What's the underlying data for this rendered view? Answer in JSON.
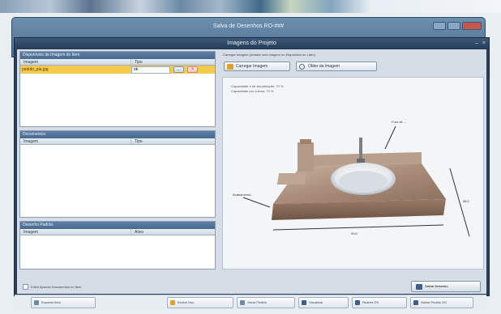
{
  "outer_window": {
    "title": "Salva de Desenhos RO-###"
  },
  "dialog": {
    "title": "Imagens do Projeto",
    "controls": {
      "minimize": "–",
      "close": "×"
    },
    "panels": {
      "images": {
        "title": "Disponíveis de Imagem do Item",
        "col_a": "Imagem",
        "col_b": "Tipo",
        "rows": [
          {
            "name": "pedido_pia.jpg",
            "type": "ok"
          }
        ],
        "row_btn_edit": "...",
        "row_btn_delete": "×"
      },
      "documents": {
        "title": "Documentos",
        "col_a": "Imagem",
        "col_b": "Tipo"
      },
      "other": {
        "title": "Desenho Padrão",
        "col_a": "Imagem",
        "col_b": "Ativo"
      }
    },
    "right": {
      "hint": "Carregar Imagem (Arraste uma imagem ou Dispositivo ao Lado)",
      "btn_load": "Carregar Imagem",
      "btn_view": "Obter da Imagem",
      "info_line1": "Capacidade e de visualização: 70 %",
      "info_line2": "Capacidade por coluna: 70 %",
      "annot_top": "Furo de ...",
      "annot_left": "Acabamento",
      "annot_bottom": "99,0",
      "annot_right": "58,0"
    },
    "footer": {
      "checkbox_label": "Exibir Apenas Documentos do Item",
      "save": "Salvar Desenho"
    }
  },
  "bottom_bar": {
    "buttons": [
      "Exportar Item",
      "Excluir Doc.",
      "Gerar Pedido",
      "Visualizar",
      "Reabrir OS",
      "Salvar Pedido OS"
    ]
  },
  "colors": {
    "title_bar": "#2a3f57",
    "panel_head": "#476a91",
    "selected_row": "#f5c84e"
  }
}
